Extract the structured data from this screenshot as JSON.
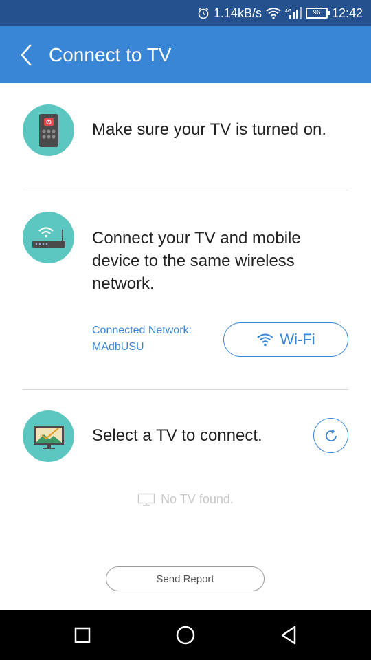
{
  "status_bar": {
    "net_speed": "1.14kB/s",
    "battery": "96",
    "time": "12:42"
  },
  "app_bar": {
    "title": "Connect to TV"
  },
  "steps": {
    "power": {
      "text": "Make sure your TV is turned on."
    },
    "network": {
      "text": "Connect your TV and mobile device to the same wireless network.",
      "connected_label": "Connected Network:",
      "network_name": "MAdbUSU",
      "wifi_button": "Wi-Fi"
    },
    "select": {
      "text": "Select a TV to connect."
    }
  },
  "empty_state": "No TV found.",
  "send_report": "Send Report",
  "colors": {
    "status_bar": "#25528f",
    "app_bar": "#3a86d6",
    "accent": "#3a86d6",
    "icon_circle": "#5cc6c0"
  }
}
